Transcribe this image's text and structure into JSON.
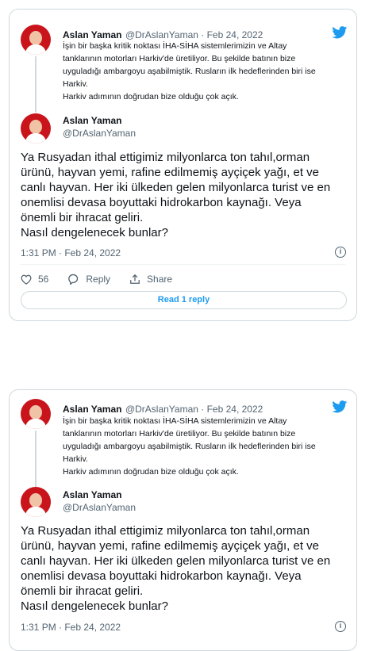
{
  "cards": [
    {
      "quoted": {
        "name": "Aslan Yaman",
        "handle_date": "@DrAslanYaman · Feb 24, 2022",
        "lines": [
          "İşin bir başka kritik noktası İHA-SİHA sistemlerimizin ve Altay",
          "tanklarının motorları  Harkiv'de üretiliyor. Bu şekilde batının bize",
          "uyguladığı ambargoyu aşabilmiştik. Rusların ilk hedeflerinden biri ise",
          "Harkiv.",
          "Harkiv adımının doğrudan bize olduğu çok açık."
        ]
      },
      "main": {
        "name": "Aslan Yaman",
        "handle": "@DrAslanYaman",
        "lines": [
          "Ya Rusyadan ithal ettigimiz milyonlarca ton tahıl,orman",
          "ürünü, hayvan yemi, rafine edilmemiş ayçiçek yağı, et ve",
          "canlı hayvan. Her iki ülkeden gelen milyonlarca turist ve en",
          "onemlisi devasa boyuttaki hidrokarbon kaynağı. Veya",
          "önemli bir ihracat geliri.",
          "Nasıl dengelenecek bunlar?"
        ],
        "timestamp": "1:31 PM · Feb 24, 2022"
      },
      "actions": {
        "likes": "56",
        "reply_label": "Reply",
        "share_label": "Share"
      },
      "read_replies_label": "Read 1 reply"
    },
    {
      "quoted": {
        "name": "Aslan Yaman",
        "handle_date": "@DrAslanYaman · Feb 24, 2022",
        "lines": [
          "İşin bir başka kritik noktası İHA-SİHA sistemlerimizin ve Altay",
          "tanklarının motorları  Harkiv'de üretiliyor. Bu şekilde batının bize",
          "uyguladığı ambargoyu aşabilmiştik. Rusların ilk hedeflerinden biri ise",
          "Harkiv.",
          "Harkiv adımının doğrudan bize olduğu çok açık."
        ]
      },
      "main": {
        "name": "Aslan Yaman",
        "handle": "@DrAslanYaman",
        "lines": [
          "Ya Rusyadan ithal ettigimiz milyonlarca ton tahıl,orman",
          "ürünü, hayvan yemi, rafine edilmemiş ayçiçek yağı, et ve",
          "canlı hayvan. Her iki ülkeden gelen milyonlarca turist ve en",
          "onemlisi devasa boyuttaki hidrokarbon kaynağı. Veya",
          "önemli bir ihracat geliri.",
          "Nasıl dengelenecek bunlar?"
        ],
        "timestamp": "1:31 PM · Feb 24, 2022"
      }
    }
  ],
  "colors": {
    "accent": "#1d9bf0",
    "muted": "#536471",
    "border": "#cfd9de",
    "avatar_bg": "#c9141b"
  },
  "icons": [
    "twitter-bird-icon",
    "info-icon",
    "heart-icon",
    "reply-icon",
    "share-icon"
  ]
}
